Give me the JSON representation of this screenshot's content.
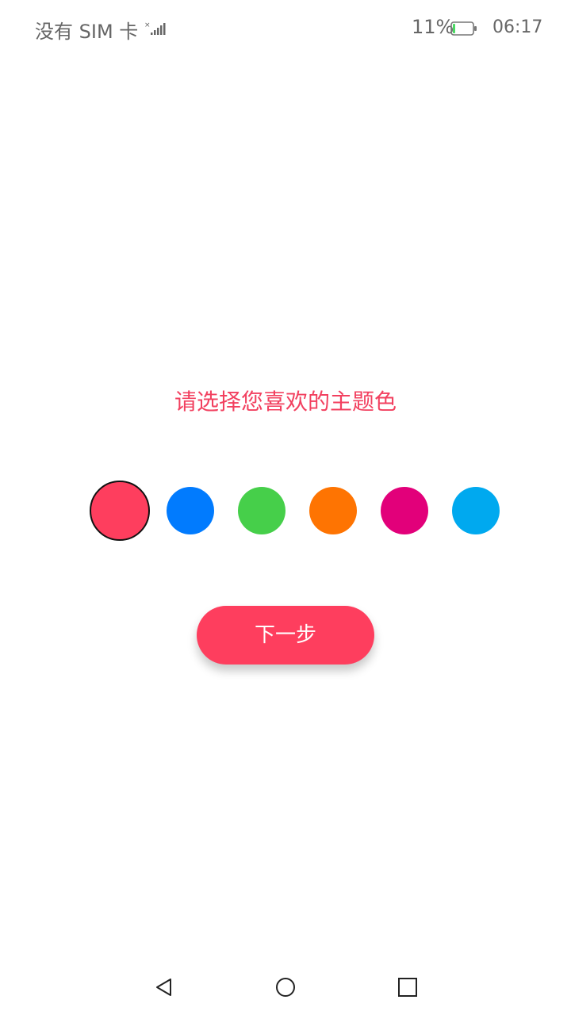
{
  "status_bar": {
    "carrier": "没有 SIM 卡",
    "battery_percent": "11%",
    "battery_level": 0.11,
    "time": "06:17",
    "icons": [
      "signal-icon",
      "battery-icon"
    ]
  },
  "main": {
    "prompt": "请选择您喜欢的主题色",
    "swatches": [
      {
        "color": "#fe3e5e",
        "selected": true
      },
      {
        "color": "#017bfe"
      },
      {
        "color": "#46cf4a"
      },
      {
        "color": "#fe7402"
      },
      {
        "color": "#e2007a"
      },
      {
        "color": "#00a9ef"
      }
    ],
    "next_button_label": "下一步"
  },
  "nav_bar": {
    "icons": [
      "back-icon",
      "home-icon",
      "recents-icon"
    ]
  },
  "colors": {
    "accent": "#fe3e5e",
    "prompt_text": "#f2405f",
    "status_text": "#666666"
  }
}
